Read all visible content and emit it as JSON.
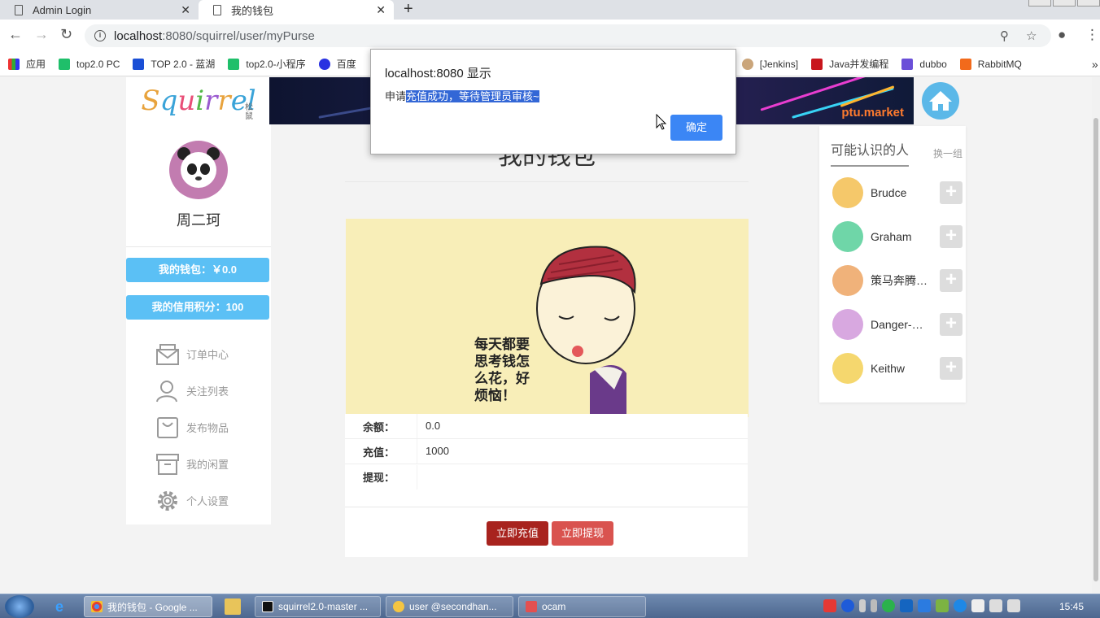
{
  "browser": {
    "tabs": [
      {
        "label": "Admin Login",
        "active": false
      },
      {
        "label": "我的钱包",
        "active": true
      }
    ],
    "url_host": "localhost",
    "url_rest": ":8080/squirrel/user/myPurse",
    "bookmarks": [
      "应用",
      "top2.0 PC",
      "TOP 2.0 - 蓝湖",
      "top2.0-小程序",
      "百度",
      "[Jenkins]",
      "Java并发编程",
      "dubbo",
      "RabbitMQ"
    ]
  },
  "site": {
    "logo_text": "Squirrel",
    "logo_sub": "松鼠",
    "banner_text": "ptu.market"
  },
  "user": {
    "name": "周二珂",
    "wallet_label": "我的钱包：￥0.0",
    "credit_label": "我的信用积分：100"
  },
  "menu": [
    {
      "label": "订单中心",
      "icon": "envelope-icon"
    },
    {
      "label": "关注列表",
      "icon": "users-icon"
    },
    {
      "label": "发布物品",
      "icon": "box-icon"
    },
    {
      "label": "我的闲置",
      "icon": "archive-icon"
    },
    {
      "label": "个人设置",
      "icon": "gear-icon"
    }
  ],
  "purse": {
    "title": "我的钱包",
    "hero_caption_lines": [
      "每天都要",
      "思考钱怎",
      "么花，好",
      "烦恼！"
    ],
    "balance_label": "余额：",
    "balance_value": "0.0",
    "charge_label": "充值：",
    "charge_value": "1000",
    "withdraw_label": "提现：",
    "withdraw_value": "",
    "charge_button": "立即充值",
    "withdraw_button": "立即提现"
  },
  "suggestions": {
    "title": "可能认识的人",
    "refresh": "换一组",
    "people": [
      {
        "name": "Brudce",
        "color": "#f5c86a"
      },
      {
        "name": "Graham",
        "color": "#6fd6a8"
      },
      {
        "name": "策马奔腾…",
        "color": "#f0b27a"
      },
      {
        "name": "Danger-…",
        "color": "#d8a8e0"
      },
      {
        "name": "Keithw",
        "color": "#f5d76e"
      }
    ]
  },
  "dialog": {
    "title": "localhost:8080 显示",
    "message_prefix": "申请",
    "message_selected": "充值成功，等待管理员审核~",
    "ok_label": "确定"
  },
  "taskbar": {
    "tasks": [
      "我的钱包 - Google ...",
      "squirrel2.0-master ...",
      "user @secondhan...",
      "ocam"
    ],
    "clock": "15:45"
  }
}
